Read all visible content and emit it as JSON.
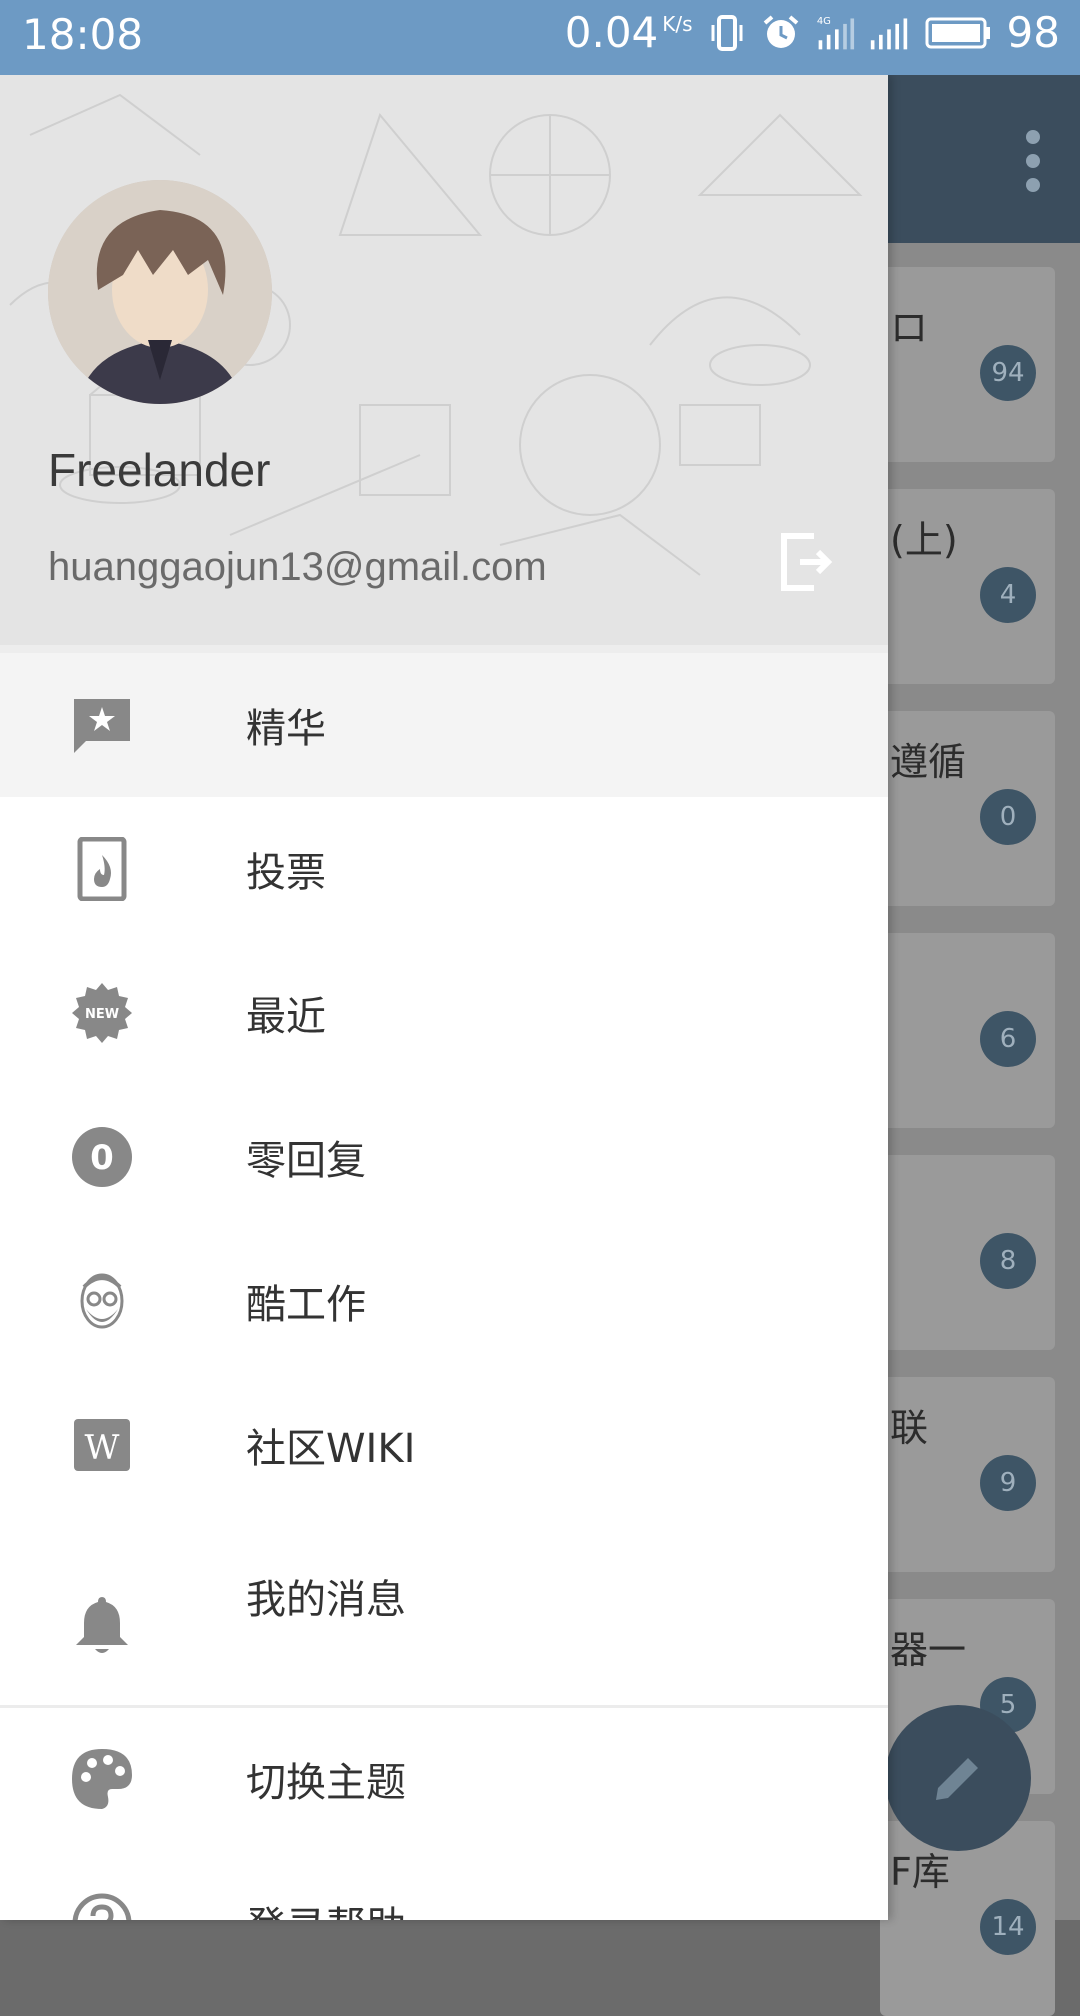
{
  "status_bar": {
    "time": "18:08",
    "net_speed": "0.04",
    "net_unit": "K/s",
    "battery": "98",
    "icons": [
      "vibrate-icon",
      "alarm-icon",
      "4g-signal-icon",
      "signal-icon",
      "battery-icon"
    ]
  },
  "background": {
    "cards": [
      {
        "text": "ロ",
        "count": "94"
      },
      {
        "text": "(上)",
        "count": "4"
      },
      {
        "text": "遵循",
        "count": "0"
      },
      {
        "text": "",
        "count": "6"
      },
      {
        "text": "",
        "count": "8"
      },
      {
        "text": "联",
        "count": "9"
      },
      {
        "text": "器一",
        "count": "5"
      },
      {
        "text": "F库",
        "count": "14"
      }
    ]
  },
  "drawer": {
    "user": {
      "name": "Freelander",
      "email": "huanggaojun13@gmail.com"
    },
    "items": [
      {
        "label": "精华",
        "icon": "star-chat-icon",
        "active": true
      },
      {
        "label": "投票",
        "icon": "fire-card-icon"
      },
      {
        "label": "最近",
        "icon": "new-badge-icon"
      },
      {
        "label": "零回复",
        "icon": "zero-circle-icon"
      },
      {
        "label": "酷工作",
        "icon": "jobs-face-icon"
      },
      {
        "label": "社区WIKI",
        "icon": "wiki-icon"
      },
      {
        "label": "我的消息",
        "icon": "bell-icon"
      }
    ],
    "footer_items": [
      {
        "label": "切换主题",
        "icon": "palette-icon"
      },
      {
        "label": "登录帮助",
        "icon": "help-circle-icon"
      }
    ]
  }
}
